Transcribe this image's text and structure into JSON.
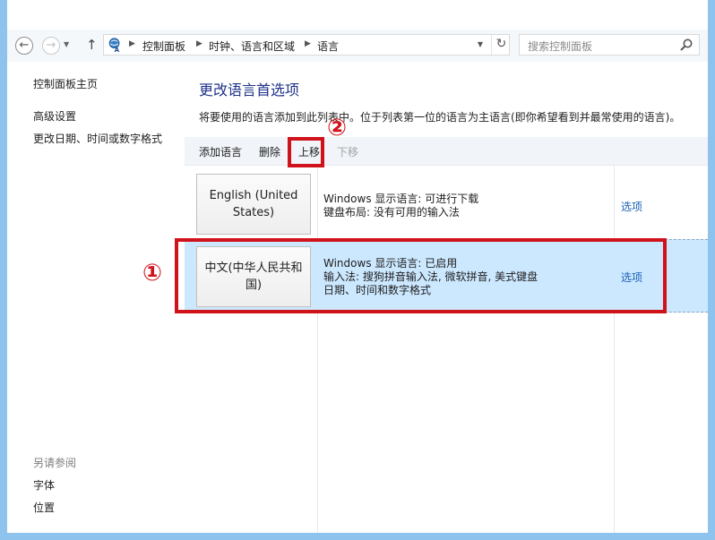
{
  "window": {
    "title": "语言",
    "accent_color": "#8dc3ec",
    "close_color": "#c7403a"
  },
  "nav": {
    "breadcrumbs": [
      "控制面板",
      "时钟、语言和区域",
      "语言"
    ],
    "search_placeholder": "搜索控制面板"
  },
  "sidebar": {
    "home": "控制面板主页",
    "links": [
      "高级设置",
      "更改日期、时间或数字格式"
    ],
    "see_also_heading": "另请参阅",
    "see_also_links": [
      "字体",
      "位置"
    ]
  },
  "main": {
    "title": "更改语言首选项",
    "description": "将要使用的语言添加到此列表中。位于列表第一位的语言为主语言(即你希望看到并最常使用的语言)。",
    "toolbar": {
      "add": "添加语言",
      "remove": "删除",
      "move_up": "上移",
      "move_down": "下移"
    },
    "languages": [
      {
        "name": "English (United States)",
        "info": [
          "Windows 显示语言: 可进行下载",
          "键盘布局: 没有可用的输入法"
        ],
        "options": "选项",
        "selected": false
      },
      {
        "name": "中文(中华人民共和国)",
        "info": [
          "Windows 显示语言: 已启用",
          "输入法: 搜狗拼音输入法, 微软拼音, 美式键盘",
          "日期、时间和数字格式"
        ],
        "options": "选项",
        "selected": true
      }
    ]
  },
  "annotations": {
    "marker_1": "①",
    "marker_2": "②",
    "color": "#d0121b"
  }
}
